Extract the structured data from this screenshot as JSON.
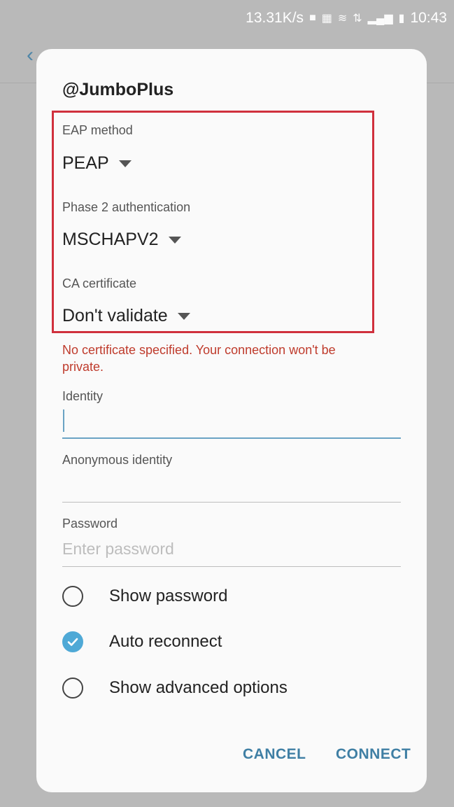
{
  "status_bar": {
    "speed": "13.31K/s",
    "time": "10:43"
  },
  "dialog": {
    "title": "@JumboPlus",
    "eap": {
      "label": "EAP method",
      "value": "PEAP"
    },
    "phase2": {
      "label": "Phase 2 authentication",
      "value": "MSCHAPV2"
    },
    "ca_cert": {
      "label": "CA certificate",
      "value": "Don't validate"
    },
    "warning": "No certificate specified. Your connection won't be private.",
    "identity": {
      "label": "Identity",
      "value": ""
    },
    "anonymous_identity": {
      "label": "Anonymous identity",
      "value": ""
    },
    "password": {
      "label": "Password",
      "placeholder": "Enter password",
      "value": ""
    },
    "options": [
      {
        "label": "Show password",
        "checked": false
      },
      {
        "label": "Auto reconnect",
        "checked": true
      },
      {
        "label": "Show advanced options",
        "checked": false
      }
    ],
    "buttons": {
      "cancel": "CANCEL",
      "connect": "CONNECT"
    }
  },
  "colors": {
    "accent": "#3f7fa4",
    "highlight_border": "#d0303d",
    "warning": "#bf3b2c",
    "checkbox_checked": "#4fa9d6"
  }
}
